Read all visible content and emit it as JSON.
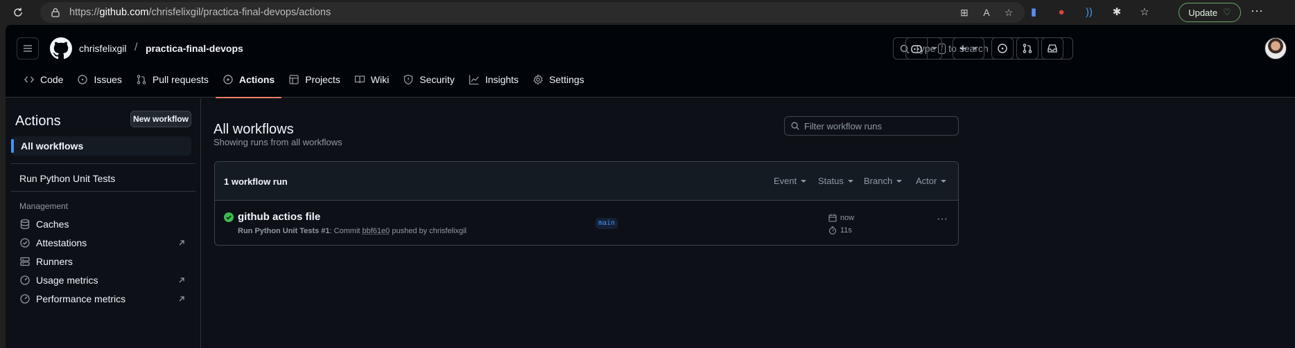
{
  "browser": {
    "url_scheme": "https://",
    "url_host": "github.com",
    "url_path": "/chrisfelixgil/practica-final-devops/actions",
    "update_label": "Update"
  },
  "header": {
    "owner": "chrisfelixgil",
    "separator": "/",
    "repo": "practica-final-devops",
    "search_prefix": "Type",
    "search_key": "/",
    "search_suffix": "to search"
  },
  "tabs": [
    {
      "label": "Code",
      "icon": "code-icon"
    },
    {
      "label": "Issues",
      "icon": "issue-icon"
    },
    {
      "label": "Pull requests",
      "icon": "pull-request-icon"
    },
    {
      "label": "Actions",
      "icon": "play-icon",
      "selected": true
    },
    {
      "label": "Projects",
      "icon": "table-icon"
    },
    {
      "label": "Wiki",
      "icon": "book-icon"
    },
    {
      "label": "Security",
      "icon": "shield-icon"
    },
    {
      "label": "Insights",
      "icon": "graph-icon"
    },
    {
      "label": "Settings",
      "icon": "gear-icon"
    }
  ],
  "sidebar": {
    "title": "Actions",
    "new_workflow": "New workflow",
    "all_workflows": "All workflows",
    "workflows": [
      "Run Python Unit Tests"
    ],
    "management_heading": "Management",
    "management": [
      {
        "label": "Caches",
        "icon": "database-icon"
      },
      {
        "label": "Attestations",
        "icon": "verified-icon",
        "external": true
      },
      {
        "label": "Runners",
        "icon": "server-icon"
      },
      {
        "label": "Usage metrics",
        "icon": "meter-icon",
        "external": true
      },
      {
        "label": "Performance metrics",
        "icon": "meter-icon",
        "external": true
      }
    ]
  },
  "main": {
    "title": "All workflows",
    "subtitle": "Showing runs from all workflows",
    "filter_placeholder": "Filter workflow runs",
    "runs_count": "1 workflow run",
    "filters": [
      "Event",
      "Status",
      "Branch",
      "Actor"
    ],
    "run": {
      "title": "github actios file",
      "workflow": "Run Python Unit Tests",
      "number": "#1",
      "meta_middle": ": Commit",
      "sha": "bbf61e0",
      "meta_end": "pushed by chrisfelixgil",
      "branch": "main",
      "when": "now",
      "duration": "11s",
      "status": "success"
    }
  },
  "colors": {
    "accent": "#f78166",
    "link": "#4493f8",
    "success": "#3fb950"
  }
}
